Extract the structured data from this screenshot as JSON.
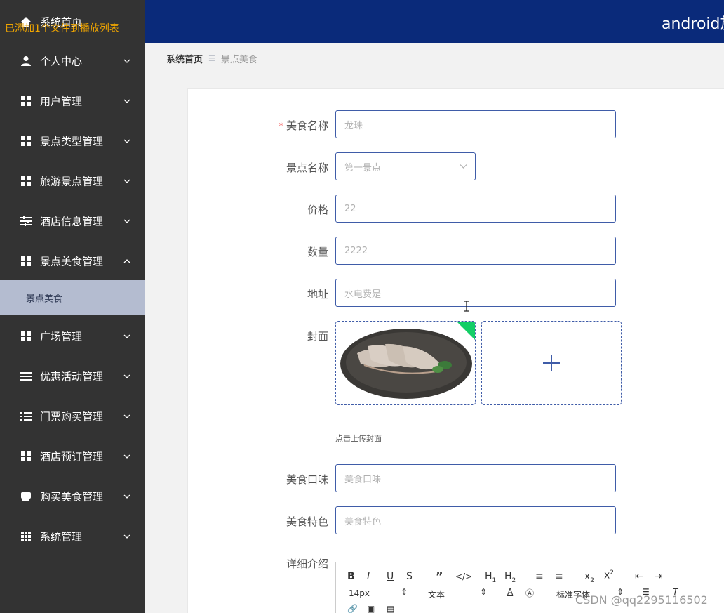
{
  "app": {
    "header_title": "android旅",
    "toast": "已添加1个文件到播放列表",
    "watermark": "CSDN @qq2295116502"
  },
  "sidebar": {
    "items": [
      {
        "label": "系统首页",
        "icon": "home-icon"
      },
      {
        "label": "个人中心",
        "icon": "user-icon",
        "expanded": false
      },
      {
        "label": "用户管理",
        "icon": "grid-icon",
        "expanded": false
      },
      {
        "label": "景点类型管理",
        "icon": "grid-icon",
        "expanded": false
      },
      {
        "label": "旅游景点管理",
        "icon": "grid-icon",
        "expanded": false
      },
      {
        "label": "酒店信息管理",
        "icon": "sliders-icon",
        "expanded": false
      },
      {
        "label": "景点美食管理",
        "icon": "grid-icon",
        "expanded": true
      },
      {
        "label": "广场管理",
        "icon": "grid-icon",
        "expanded": false
      },
      {
        "label": "优惠活动管理",
        "icon": "list-icon",
        "expanded": false
      },
      {
        "label": "门票购买管理",
        "icon": "list-icon",
        "expanded": false
      },
      {
        "label": "酒店预订管理",
        "icon": "grid-icon",
        "expanded": false
      },
      {
        "label": "购买美食管理",
        "icon": "bag-icon",
        "expanded": false
      },
      {
        "label": "系统管理",
        "icon": "apps-icon",
        "expanded": false
      }
    ],
    "active_sub_item": "景点美食"
  },
  "breadcrumb": {
    "home": "系统首页",
    "current": "景点美食"
  },
  "form": {
    "food_name": {
      "label": "美食名称",
      "value": "龙珠",
      "required": true
    },
    "spot_name": {
      "label": "景点名称",
      "value": "第一景点"
    },
    "price": {
      "label": "价格",
      "value": "22"
    },
    "quantity": {
      "label": "数量",
      "value": "2222"
    },
    "address": {
      "label": "地址",
      "value": "水电费是"
    },
    "cover": {
      "label": "封面",
      "tip": "点击上传封面"
    },
    "taste": {
      "label": "美食口味",
      "placeholder": "美食口味"
    },
    "feature": {
      "label": "美食特色",
      "placeholder": "美食特色"
    },
    "detail": {
      "label": "详细介绍"
    }
  },
  "editor_toolbar": {
    "font_size": "14px",
    "paragraph": "文本",
    "font_family": "标准字体"
  },
  "colors": {
    "sidebar_bg": "#333333",
    "header_bg": "#0a2a7a",
    "active_sub_bg": "#b4bcd0",
    "input_border": "#3f5ca8",
    "toast": "#f0a500"
  }
}
